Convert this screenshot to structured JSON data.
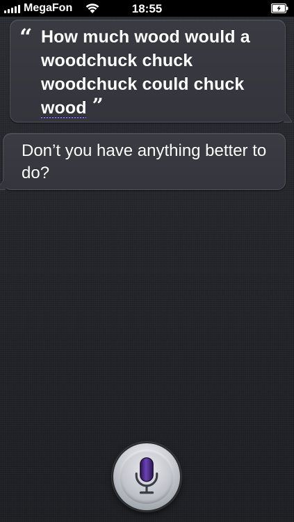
{
  "status_bar": {
    "carrier": "MegaFon",
    "time": "18:55",
    "signal_bars": 5,
    "wifi_icon": "wifi-icon",
    "battery_icon": "battery-charging-icon"
  },
  "conversation": {
    "user_query": "How much wood would a woodchuck chuck woodchuck could chuck",
    "user_query_last_word": "wood",
    "quote_open": "“",
    "quote_close": "”",
    "siri_response": "Don’t you have anything better to do?"
  },
  "controls": {
    "microphone_icon": "microphone-icon"
  },
  "colors": {
    "background": "#26272d",
    "bubble": "#36373e",
    "mic_accent": "#4b2a86",
    "spellcheck_underline": "#7b6ae0"
  }
}
